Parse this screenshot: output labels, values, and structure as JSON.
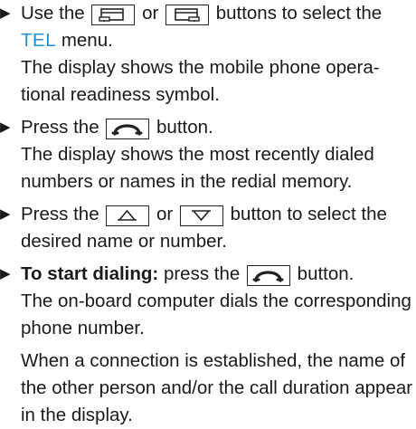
{
  "steps": [
    {
      "pre": "Use the",
      "mid": "or",
      "post": "buttons to select the",
      "tel": "TEL",
      "post2": "menu.",
      "result": "The display shows the mobile phone opera­tional readiness symbol."
    },
    {
      "pre": "Press the",
      "post": "button.",
      "result": "The display shows the most recently dialed numbers or names in the redial memory."
    },
    {
      "pre": "Press the",
      "mid": "or",
      "post": "button to select the desired name or number."
    },
    {
      "bold": "To start dialing:",
      "pre": "press the",
      "post": "button.",
      "result": "The on-board computer dials the corre­sponding phone number.",
      "result2": "When a connection is established, the name of the other person and/or the call duration appear in the display."
    }
  ],
  "icons": {
    "prev_display": "display-back-icon",
    "next_display": "display-forward-icon",
    "phone": "phone-receiver-icon",
    "up": "arrow-up-icon",
    "down": "arrow-down-icon"
  }
}
